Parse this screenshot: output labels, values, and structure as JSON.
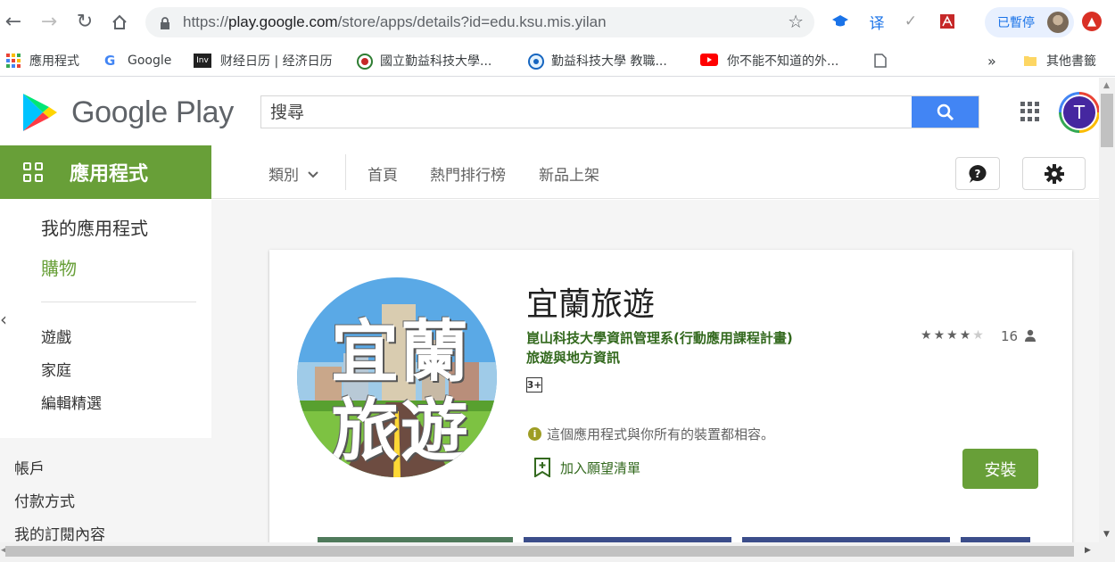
{
  "browser": {
    "url_prefix": "https://",
    "url_host": "play.google.com",
    "url_path": "/store/apps/details?id=edu.ksu.mis.yilan",
    "profile_status": "已暫停",
    "translate_ext": "译",
    "bookmarks": [
      {
        "label": "應用程式",
        "icon": "apps-grid-icon"
      },
      {
        "label": "Google",
        "icon": "google-icon"
      },
      {
        "label": "财经日历 | 经济日历",
        "icon": "inv-icon"
      },
      {
        "label": "國立勤益科技大學...",
        "icon": "ncut-icon"
      },
      {
        "label": "勤益科技大學 教職...",
        "icon": "ncut-staff-icon"
      },
      {
        "label": "你不能不知道的外...",
        "icon": "youtube-icon"
      },
      {
        "label": "",
        "icon": "page-icon"
      }
    ],
    "overflow": "»",
    "other_bookmarks": "其他書籤"
  },
  "play": {
    "brand": "Google Play",
    "search_placeholder": "搜尋",
    "avatar_letter": "T",
    "section": "應用程式",
    "subnav": {
      "category": "類別",
      "home": "首頁",
      "top_charts": "熱門排行榜",
      "new_releases": "新品上架"
    }
  },
  "sidebar": {
    "my_apps": "我的應用程式",
    "shop": "購物",
    "items": [
      "遊戲",
      "家庭",
      "編輯精選"
    ],
    "account": [
      "帳戶",
      "付款方式",
      "我的訂閱內容"
    ]
  },
  "app": {
    "title": "宜蘭旅遊",
    "icon_text": [
      "宜",
      "蘭",
      "旅",
      "遊"
    ],
    "developer": "崑山科技大學資訊管理系(行動應用課程計畫)",
    "genre": "旅遊與地方資訊",
    "content_rating": "3+",
    "rating": 4,
    "rating_max": 5,
    "rating_count": "16",
    "compatibility": "這個應用程式與你所有的裝置都相容。",
    "wishlist": "加入願望清單",
    "install": "安裝"
  },
  "colors": {
    "play_green": "#689f38",
    "dev_green": "#33691e",
    "search_blue": "#4285f4",
    "avatar_bg": "#4527a0"
  }
}
